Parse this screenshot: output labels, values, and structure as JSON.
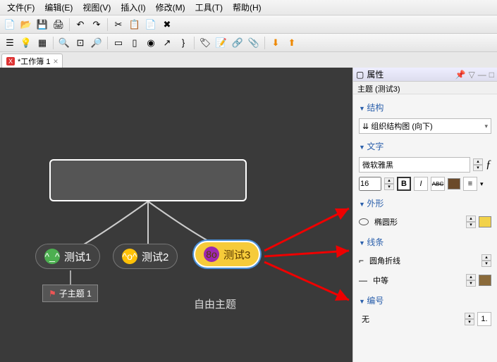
{
  "menu": {
    "file": "文件(F)",
    "edit": "编辑(E)",
    "view": "视图(V)",
    "insert": "插入(I)",
    "modify": "修改(M)",
    "tools": "工具(T)",
    "help": "帮助(H)"
  },
  "tab": {
    "title": "*工作簿 1"
  },
  "canvas": {
    "child1": "测试1",
    "child2": "测试2",
    "child3": "测试3",
    "subtopic": "子主题 1",
    "freelabel": "自由主题"
  },
  "panel": {
    "title": "属性",
    "subtitle": "主题 (测试3)",
    "sec_structure": "结构",
    "structure_value": "组织结构图 (向下)",
    "sec_text": "文字",
    "font_family": "微软雅黑",
    "font_size": "16",
    "bold": "B",
    "italic": "I",
    "strike": "ABC",
    "sec_shape": "外形",
    "shape_value": "椭圆形",
    "sec_line": "线条",
    "line_style": "圆角折线",
    "line_weight": "中等",
    "sec_number": "编号",
    "number_value": "无"
  },
  "colors": {
    "text": "#6b4a2a",
    "shape": "#f2d24a",
    "line": "#8a6a3a"
  }
}
